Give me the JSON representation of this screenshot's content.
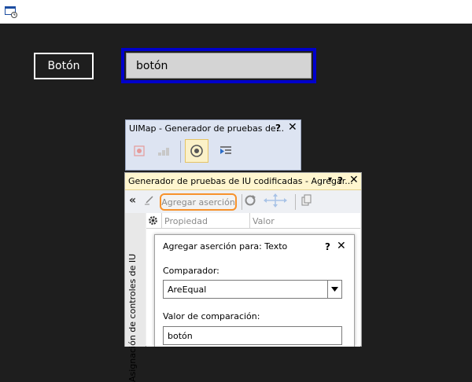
{
  "titlebar": {
    "icon": "window-app-icon"
  },
  "app": {
    "button_label": "Botón",
    "textbox_value": "botón",
    "highlight_color": "#0000cc"
  },
  "uimap": {
    "title": "UIMap - Generador de pruebas de...",
    "help": "?",
    "close": "✕",
    "icons": [
      "record-icon",
      "steps-icon",
      "crosshair-target-icon",
      "generate-code-icon"
    ]
  },
  "builder": {
    "title": "Generador de pruebas de IU codificadas - Agregar...",
    "dropdown": "▾",
    "help": "?",
    "close": "✕",
    "collapse": "«",
    "add_assertion_label": "Agregar aserción",
    "add_assertion_outline_color": "#f7922c",
    "side_label": "Asignación de controles de IU",
    "columns": [
      "Propiedad",
      "Valor"
    ]
  },
  "dialog": {
    "title": "Agregar aserción para: Texto",
    "help": "?",
    "close": "✕",
    "comparator_label": "Comparador:",
    "comparator_value": "AreEqual",
    "comparison_label": "Valor de comparación:",
    "comparison_value": "botón"
  }
}
